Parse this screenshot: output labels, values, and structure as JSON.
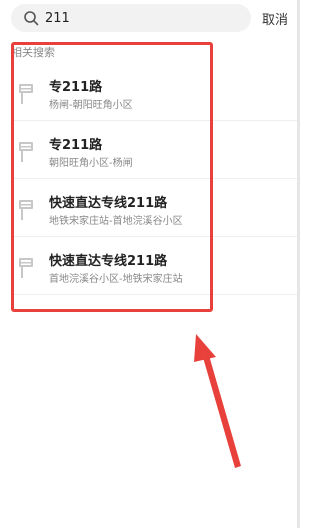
{
  "search": {
    "value": "211",
    "cancel_label": "取消"
  },
  "section": {
    "label": "相关搜索"
  },
  "results": [
    {
      "title": "专211路",
      "subtitle": "杨闸-朝阳旺角小区"
    },
    {
      "title": "专211路",
      "subtitle": "朝阳旺角小区-杨闸"
    },
    {
      "title": "快速直达专线211路",
      "subtitle": "地铁宋家庄站-首地浣溪谷小区"
    },
    {
      "title": "快速直达专线211路",
      "subtitle": "首地浣溪谷小区-地铁宋家庄站"
    }
  ],
  "colors": {
    "annotation_red": "#e8413c",
    "icon_gray": "#c7c7c7"
  }
}
